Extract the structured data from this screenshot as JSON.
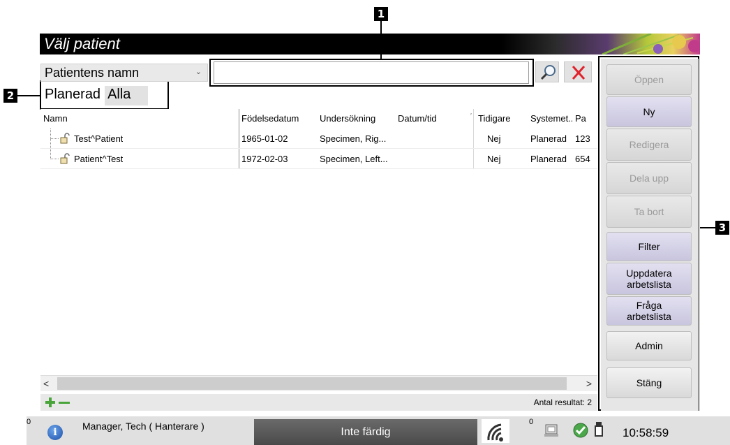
{
  "callouts": {
    "c1": "1",
    "c2": "2",
    "c3": "3"
  },
  "window": {
    "title": "Välj patient"
  },
  "search": {
    "field_selected": "Patientens namn",
    "value": ""
  },
  "tabs": {
    "planned": "Planerad",
    "all": "Alla"
  },
  "table": {
    "headers": [
      "Namn",
      "Födelsedatum",
      "Undersökning",
      "Datum/tid",
      "Tidigare",
      "Systemet...",
      "Pa"
    ],
    "rows": [
      {
        "name": "Test^Patient",
        "dob": "1965-01-02",
        "exam": "Specimen, Rig...",
        "datetime": "",
        "previous": "Nej",
        "system": "Planerad",
        "pa": "123"
      },
      {
        "name": "Patient^Test",
        "dob": "1972-02-03",
        "exam": "Specimen, Left...",
        "datetime": "",
        "previous": "Nej",
        "system": "Planerad",
        "pa": "654"
      }
    ]
  },
  "footer": {
    "result_count": "Antal resultat: 2"
  },
  "side_buttons": {
    "open": "Öppen",
    "new": "Ny",
    "edit": "Redigera",
    "split": "Dela upp",
    "delete": "Ta bort",
    "filter": "Filter",
    "refresh": "Uppdatera arbetslista",
    "query": "Fråga arbetslista",
    "admin": "Admin",
    "close": "Stäng"
  },
  "taskbar": {
    "left_count": "0",
    "user": "Manager, Tech ( Hanterare )",
    "status": "Inte färdig",
    "tray_count": "0",
    "time": "10:58:59"
  },
  "colors": {
    "titlebar": "#000000",
    "add_green": "#49a53a",
    "clear_red": "#e0232d",
    "status_bg": "#555555"
  }
}
